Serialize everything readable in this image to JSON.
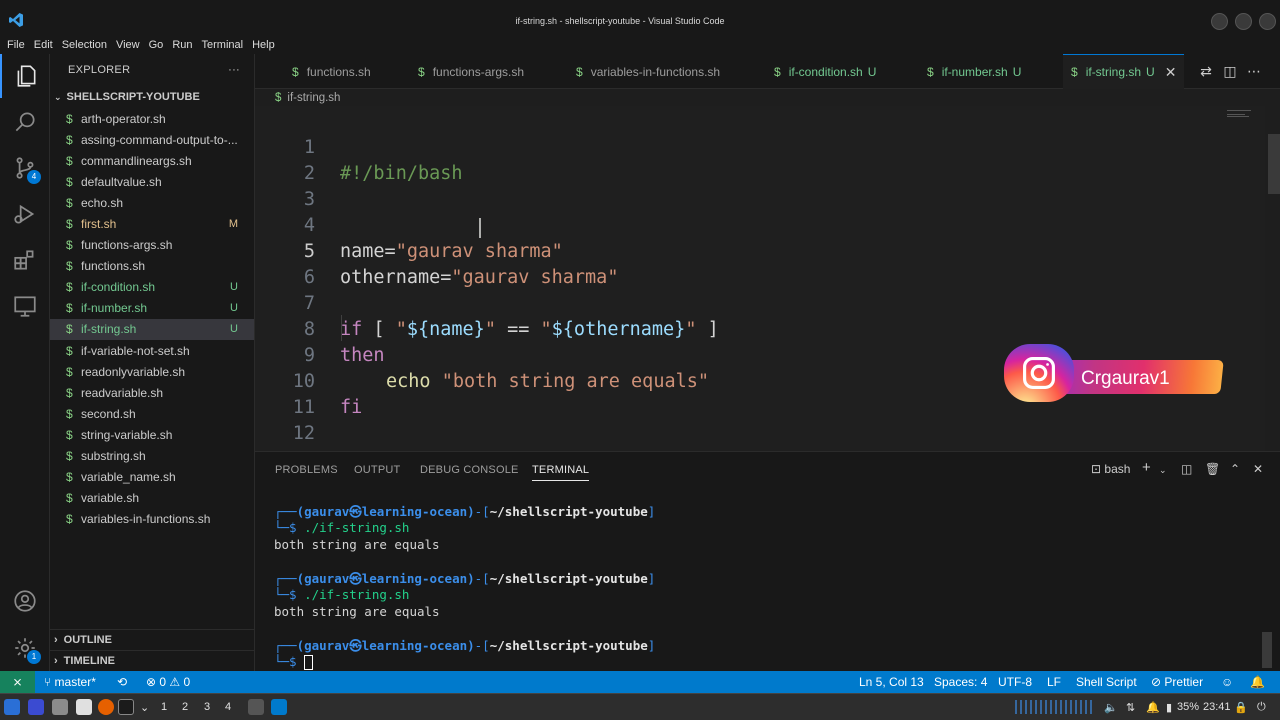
{
  "window": {
    "title": "if-string.sh - shellscript-youtube - Visual Studio Code"
  },
  "menu": [
    "File",
    "Edit",
    "Selection",
    "View",
    "Go",
    "Run",
    "Terminal",
    "Help"
  ],
  "activity_bar": {
    "source_control_badge": "4",
    "settings_badge": "1"
  },
  "explorer": {
    "header": "EXPLORER",
    "more": "···",
    "folder": "SHELLSCRIPT-YOUTUBE",
    "files": [
      {
        "name": "arth-operator.sh",
        "status": ""
      },
      {
        "name": "assing-command-output-to-...",
        "status": ""
      },
      {
        "name": "commandlineargs.sh",
        "status": ""
      },
      {
        "name": "defaultvalue.sh",
        "status": ""
      },
      {
        "name": "echo.sh",
        "status": ""
      },
      {
        "name": "first.sh",
        "status": "M"
      },
      {
        "name": "functions-args.sh",
        "status": ""
      },
      {
        "name": "functions.sh",
        "status": ""
      },
      {
        "name": "if-condition.sh",
        "status": "U"
      },
      {
        "name": "if-number.sh",
        "status": "U"
      },
      {
        "name": "if-string.sh",
        "status": "U"
      },
      {
        "name": "if-variable-not-set.sh",
        "status": ""
      },
      {
        "name": "readonlyvariable.sh",
        "status": ""
      },
      {
        "name": "readvariable.sh",
        "status": ""
      },
      {
        "name": "second.sh",
        "status": ""
      },
      {
        "name": "string-variable.sh",
        "status": ""
      },
      {
        "name": "substring.sh",
        "status": ""
      },
      {
        "name": "variable_name.sh",
        "status": ""
      },
      {
        "name": "variable.sh",
        "status": ""
      },
      {
        "name": "variables-in-functions.sh",
        "status": ""
      }
    ],
    "outline": "OUTLINE",
    "timeline": "TIMELINE"
  },
  "tabs": [
    {
      "label": "functions.sh",
      "status": ""
    },
    {
      "label": "functions-args.sh",
      "status": ""
    },
    {
      "label": "variables-in-functions.sh",
      "status": ""
    },
    {
      "label": "if-condition.sh",
      "status": "U"
    },
    {
      "label": "if-number.sh",
      "status": "U"
    },
    {
      "label": "if-string.sh",
      "status": "U"
    }
  ],
  "breadcrumb": "if-string.sh",
  "editor": {
    "line_numbers": [
      "1",
      "2",
      "3",
      "4",
      "5",
      "6",
      "7",
      "8",
      "9",
      "10",
      "11",
      "12"
    ],
    "code": {
      "l1": "#!/bin/bash",
      "l4_name": "name=",
      "l4_value": "\"gaurav sharma\"",
      "l5_name": "othername=",
      "l5_value": "\"gaurav sharma\"",
      "l7_if": "if",
      "l7_open": " [ ",
      "l7_q1": "\"",
      "l7_var1": "${name}",
      "l7_q2": "\"",
      "l7_eq": " == ",
      "l7_q3": "\"",
      "l7_var2": "${othername}",
      "l7_q4": "\"",
      "l7_close": " ]",
      "l8": "then",
      "l9_cmd": "echo",
      "l9_str": "\"both string are equals\"",
      "l10": "fi"
    }
  },
  "watermark": {
    "handle": "Crgaurav1"
  },
  "panel": {
    "tabs": [
      "PROBLEMS",
      "OUTPUT",
      "DEBUG CONSOLE",
      "TERMINAL"
    ],
    "shell": "bash"
  },
  "terminal": {
    "prompt_user": "(gaurav㉿learning-ocean)",
    "prompt_dash": "-[",
    "prompt_path": "~/shellscript-youtube",
    "prompt_end": "]",
    "prompt_top": "┌──",
    "prompt_bottom": "└─$",
    "command": " ./if-string.sh",
    "output": "both string are equals"
  },
  "statusbar": {
    "branch": "master*",
    "problems": "⊗ 0 ⚠ 0",
    "position": "Ln 5, Col 13",
    "spaces": "Spaces: 4",
    "encoding": "UTF-8",
    "eol": "LF",
    "language": "Shell Script",
    "formatter": "Prettier"
  },
  "taskbar": {
    "workspaces": [
      "1",
      "2",
      "3",
      "4"
    ],
    "battery": "35%",
    "time": "23:41"
  }
}
